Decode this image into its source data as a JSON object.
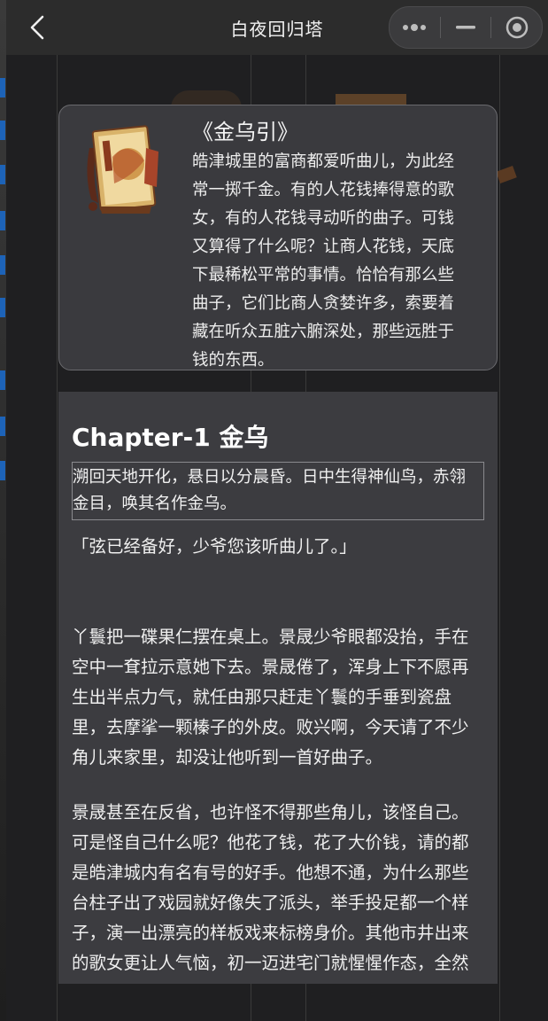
{
  "titlebar": {
    "title": "白夜回归塔",
    "back_icon": "back-arrow-icon",
    "menu_icon": "more-dots-icon",
    "minimize_icon": "minimize-icon",
    "close_icon": "target-circle-icon"
  },
  "intro": {
    "book_title": "《金乌引》",
    "description": "皓津城里的富商都爱听曲儿，为此经常一掷千金。有的人花钱捧得意的歌女，有的人花钱寻动听的曲子。可钱又算得了什么呢？让商人花钱，天底下最稀松平常的事情。恰恰有那么些曲子，它们比商人贪婪许多，索要着藏在听众五脏六腑深处，那些远胜于钱的东西。"
  },
  "chapter": {
    "title": "Chapter-1 金乌",
    "quote": "溯回天地开化，悬日以分晨昏。日中生得神仙鸟，赤翎金目，唤其名作金乌。",
    "paragraphs": [
      "「弦已经备好，少爷您该听曲儿了。」",
      "丫鬟把一碟果仁摆在桌上。景晟少爷眼都没抬，手在空中一耷拉示意她下去。景晟倦了，浑身上下不愿再生出半点力气，就任由那只赶走丫鬟的手垂到瓷盘里，去摩挲一颗榛子的外皮。败兴啊，今天请了不少角儿来家里，却没让他听到一首好曲子。",
      "景晟甚至在反省，也许怪不得那些角儿，该怪自己。可是怪自己什么呢？他花了钱，花了大价钱，请的都是皓津城内有名有号的好手。他想不通，为什么那些台柱子出了戏园就好像失了派头，举手投足都一个样子，演一出漂亮的样板戏来标榜身价。其他市井出来的歌女更让人气恼，初一迈进宅门就惺惺作态，全然没了半分烟火气，自己先砸了招"
    ]
  },
  "colors": {
    "titlebar_bg": "#2c2c2c",
    "card_bg": "#3a3a3e",
    "article_bg": "#3c3c40"
  }
}
